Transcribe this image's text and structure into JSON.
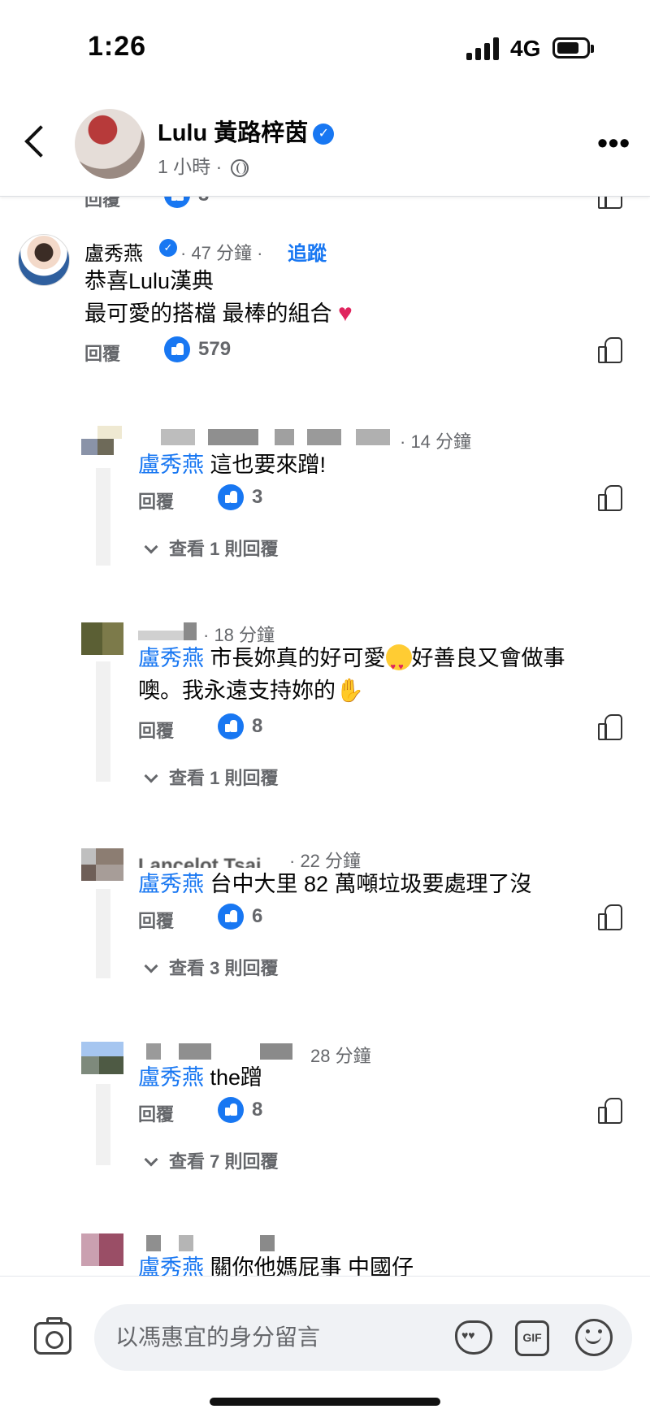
{
  "status_bar": {
    "time": "1:26",
    "network": "4G"
  },
  "header": {
    "page_name": "Lulu 黃路梓茵",
    "meta": "1 小時 ·"
  },
  "action_labels": {
    "reply": "回覆"
  },
  "top_stub": {
    "likes": "3"
  },
  "main_comment": {
    "author": "盧秀燕",
    "time": "· 47 分鐘 ·",
    "follow": "追蹤",
    "line1": "恭喜Lulu漢典",
    "line2": "最棒的組合",
    "line2_prefix": "最可愛的搭檔 ",
    "likes": "579"
  },
  "replies": [
    {
      "time": "· 14 分鐘",
      "mention": "盧秀燕",
      "text": " 這也要來蹭!",
      "likes": "3",
      "view_replies": "查看 1 則回覆"
    },
    {
      "time": "· 18 分鐘",
      "mention": "盧秀燕",
      "text_a": " 市長妳真的好可愛",
      "text_b": "好善良又會做事",
      "text_c": "噢。我永遠支持妳的",
      "likes": "8",
      "view_replies": "查看 1 則回覆"
    },
    {
      "name_fragment": "Lancelot Tsai",
      "time": "· 22 分鐘",
      "mention": "盧秀燕",
      "text": " 台中大里 82 萬噸垃圾要處理了沒",
      "likes": "6",
      "view_replies": "查看 3 則回覆"
    },
    {
      "time": "28 分鐘",
      "mention": "盧秀燕",
      "text": " the蹭",
      "likes": "8",
      "view_replies": "查看 7 則回覆"
    },
    {
      "mention": "盧秀燕",
      "text": " 關你他媽屁事 中國仔"
    }
  ],
  "compose": {
    "placeholder": "以馮惠宜的身分留言",
    "gif": "GIF"
  }
}
